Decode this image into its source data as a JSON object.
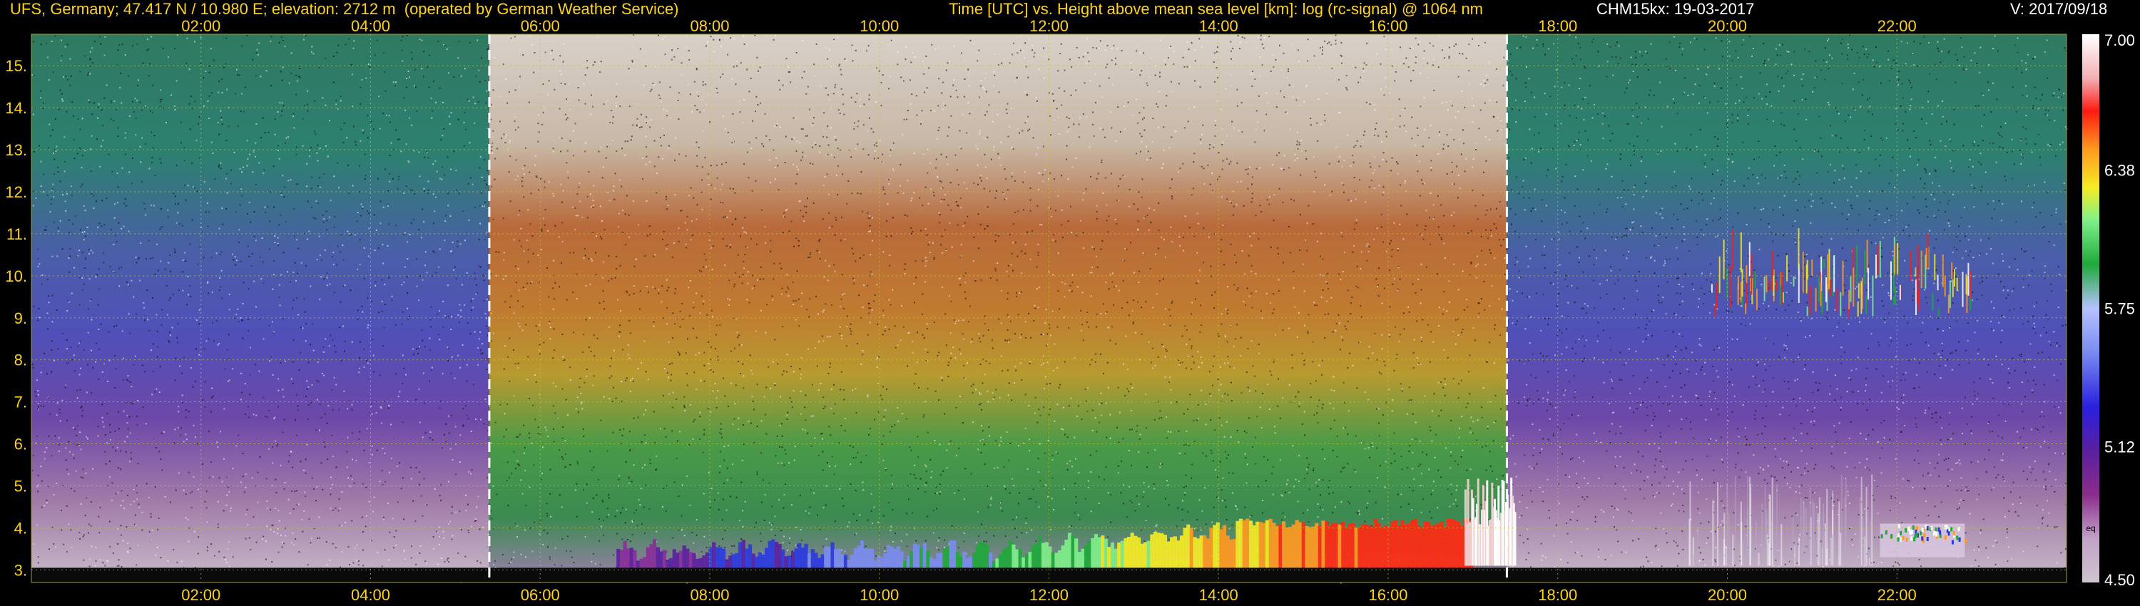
{
  "header": {
    "station": "UFS, Germany; 47.417 N / 10.980 E; elevation: 2712 m  (operated by German Weather Service)",
    "plot_title": "Time [UTC] vs. Height above mean sea level [km]: log (rc-signal) @ 1064 nm",
    "instrument": "CHM15kx: 19-03-2017",
    "version": "V: 2017/09/18"
  },
  "colors": {
    "header_text": "#ffd21e",
    "grid": "#c8c820",
    "background": "#000000",
    "sunrise_sunset_lines": "#ffffff"
  },
  "chart_data": {
    "type": "heatmap",
    "title": "Time [UTC] vs. Height above mean sea level [km]: log (rc-signal) @ 1064 nm",
    "x_ticks": [
      "02:00",
      "04:00",
      "06:00",
      "08:00",
      "10:00",
      "12:00",
      "14:00",
      "16:00",
      "18:00",
      "20:00",
      "22:00"
    ],
    "x_tick_hours": [
      2,
      4,
      6,
      8,
      10,
      12,
      14,
      16,
      18,
      20,
      22
    ],
    "x_range_hours": [
      0.0,
      24.0
    ],
    "y_ticks": [
      "3.",
      "4.",
      "5.",
      "6.",
      "7.",
      "8.",
      "9.",
      "10.",
      "11.",
      "12.",
      "13.",
      "14.",
      "15."
    ],
    "y_tick_values": [
      3,
      4,
      5,
      6,
      7,
      8,
      9,
      10,
      11,
      12,
      13,
      14,
      15
    ],
    "y_range_km": [
      2.7,
      15.75
    ],
    "grid": true,
    "vertical_markers_hours": [
      5.4,
      17.4
    ],
    "colorbar": {
      "min": 4.5,
      "max": 7.0,
      "tick_labels": [
        "7.00",
        "6.38",
        "5.75",
        "5.12",
        "4.50"
      ],
      "tick_values": [
        7.0,
        6.38,
        5.75,
        5.12,
        4.5
      ],
      "extra_label": "eq"
    },
    "features": [
      {
        "name": "boundary layer aerosol band",
        "start_hour": 6.9,
        "end_hour": 17.0,
        "base_km": 3.0,
        "top_km": [
          3.4,
          3.6,
          4.2
        ]
      },
      {
        "name": "low cloud",
        "start_hour": 16.9,
        "end_hour": 17.5,
        "base_km": 3.1,
        "top_km": 5.2
      },
      {
        "name": "cirrus",
        "start_hour": 19.8,
        "end_hour": 22.9,
        "base_km": 9.0,
        "top_km": 11.4
      },
      {
        "name": "evening low cloud",
        "start_hour": 21.8,
        "end_hour": 22.8,
        "base_km": 3.3,
        "top_km": 4.1
      }
    ]
  }
}
